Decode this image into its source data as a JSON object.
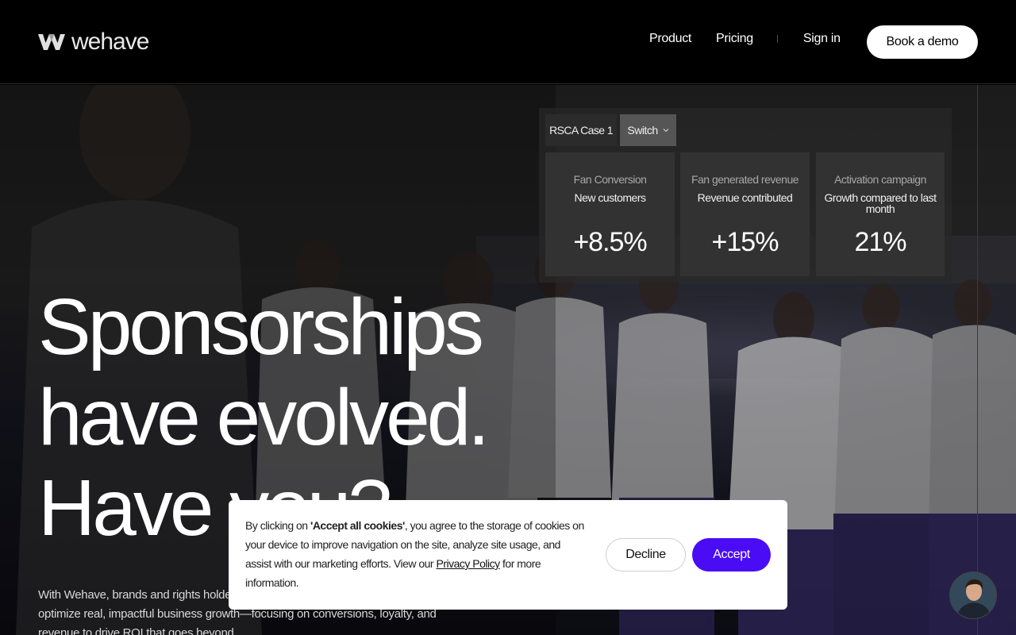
{
  "header": {
    "logo_text": "wehave",
    "nav": {
      "product": "Product",
      "pricing": "Pricing",
      "sign_in": "Sign in",
      "book_demo": "Book a demo"
    }
  },
  "stats_panel": {
    "case_label": "RSCA Case 1",
    "switch_label": "Switch",
    "cards": [
      {
        "title": "Fan Conversion",
        "subtitle": "New customers",
        "value": "+8.5%"
      },
      {
        "title": "Fan generated revenue",
        "subtitle": "Revenue contributed",
        "value": "+15%"
      },
      {
        "title": "Activation campaign",
        "subtitle": "Growth compared to last month",
        "value": "21%"
      }
    ]
  },
  "hero": {
    "line1": "Sponsorships",
    "line2": "have evolved.",
    "line3": "Have you?",
    "subtext": "With Wehave, brands and rights holders get sponsorship metrics to track and optimize real, impactful business growth—focusing on conversions, loyalty, and revenue to drive ROI that goes beyond"
  },
  "cookie_banner": {
    "text_before": "By clicking on ",
    "text_bold": "'Accept all cookies'",
    "text_middle": ", you agree to the storage of cookies on your device to improve navigation on the site, analyze site usage, and assist with our marketing efforts. View our ",
    "privacy_link": "Privacy Policy",
    "text_after": " for more information.",
    "decline": "Decline",
    "accept": "Accept"
  },
  "colors": {
    "accent": "#4a0cf4",
    "background": "#000000",
    "card": "#323232"
  },
  "icons": {
    "logo": "wehave-logo-icon",
    "switch_chevron": "chevron-down-icon",
    "chat": "chat-avatar"
  }
}
